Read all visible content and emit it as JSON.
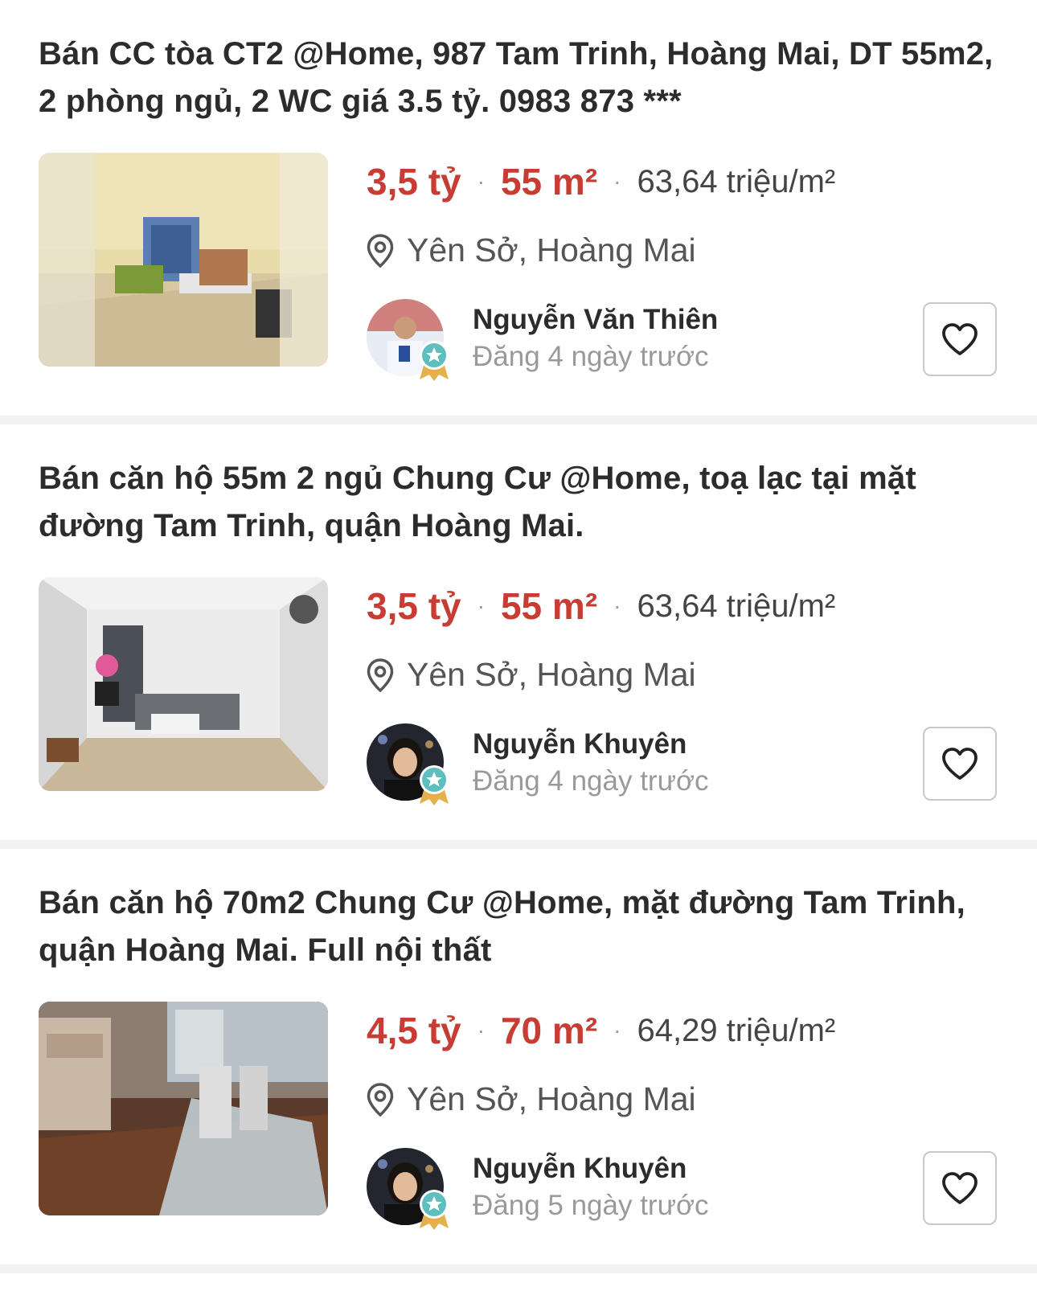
{
  "listings": [
    {
      "title": "Bán CC tòa CT2 @Home, 987 Tam Trinh, Hoàng Mai, DT 55m2, 2 phòng ngủ, 2 WC giá 3.5 tỷ. 0983 873 ***",
      "price": "3,5 tỷ",
      "area": "55 m²",
      "price_per_m2": "63,64 triệu/m²",
      "location": "Yên Sở, Hoàng Mai",
      "agent_name": "Nguyễn Văn Thiên",
      "posted": "Đăng 4 ngày trước",
      "separator": "·"
    },
    {
      "title": "Bán căn hộ 55m 2 ngủ Chung Cư @Home, toạ lạc tại mặt đường Tam Trinh, quận Hoàng Mai.",
      "price": "3,5 tỷ",
      "area": "55 m²",
      "price_per_m2": "63,64 triệu/m²",
      "location": "Yên Sở, Hoàng Mai",
      "agent_name": "Nguyễn Khuyên",
      "posted": "Đăng 4 ngày trước",
      "separator": "·"
    },
    {
      "title": "Bán căn hộ 70m2 Chung Cư @Home, mặt đường Tam Trinh, quận Hoàng Mai. Full nội thất",
      "price": "4,5 tỷ",
      "area": "70 m²",
      "price_per_m2": "64,29 triệu/m²",
      "location": "Yên Sở, Hoàng Mai",
      "agent_name": "Nguyễn Khuyên",
      "posted": "Đăng 5 ngày trước",
      "separator": "·"
    }
  ],
  "icons": {
    "location": "location-pin-icon",
    "favorite": "heart-outline-icon",
    "verified": "verified-badge-icon"
  },
  "colors": {
    "accent": "#c83d33",
    "separator_bg": "#f2f2f2"
  }
}
